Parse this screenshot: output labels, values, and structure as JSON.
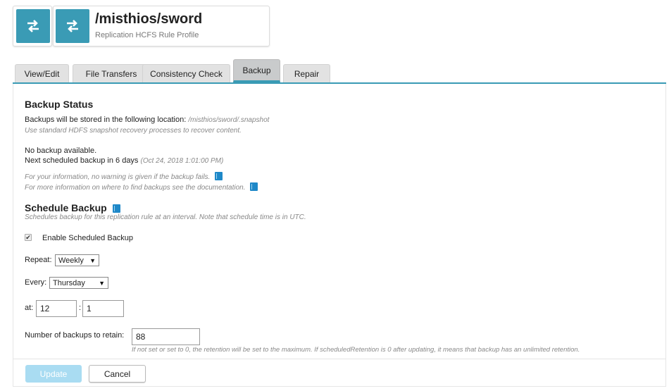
{
  "header": {
    "title": "/misthios/sword",
    "subtitle": "Replication HCFS Rule Profile",
    "left_icon": "arrows-transfer-icon",
    "title_icon": "arrows-transfer-icon",
    "accent_color": "#3a9bb5"
  },
  "tabs": [
    {
      "label": "View/Edit"
    },
    {
      "label": "File Transfers"
    },
    {
      "label": "Consistency Check"
    },
    {
      "label": "Backup",
      "active": true
    },
    {
      "label": "Repair"
    }
  ],
  "backup_status": {
    "heading": "Backup Status",
    "location_label": "Backups will be stored in the following location:",
    "location_value": "/misthios/sword/.snapshot",
    "location_note": "Use standard HDFS snapshot recovery processes to recover content.",
    "no_backup": "No backup available.",
    "next_backup": "Next scheduled backup in 6 days",
    "next_backup_time": "(Oct 24, 2018 1:01:00 PM)",
    "info_warning": "For your information, no warning is given if the backup fails.",
    "info_docs": "For more information on where to find backups see the documentation."
  },
  "schedule": {
    "heading": "Schedule Backup",
    "description": "Schedules backup for this replication rule at an interval. Note that schedule time is in UTC.",
    "enable_label": "Enable Scheduled Backup",
    "enable_checked": true,
    "repeat_label": "Repeat:",
    "repeat_value": "Weekly",
    "every_label": "Every:",
    "every_value": "Thursday",
    "at_label": "at:",
    "hour_value": "12",
    "time_separator": ":",
    "minute_value": "1",
    "retain_label": "Number of backups to retain:",
    "retain_value": "88",
    "retain_note": "If not set or set to 0, the retention will be set to the maximum. If scheduledRetention is 0 after updating, it means that backup has an unlimited retention."
  },
  "footer": {
    "update_label": "Update",
    "cancel_label": "Cancel"
  }
}
